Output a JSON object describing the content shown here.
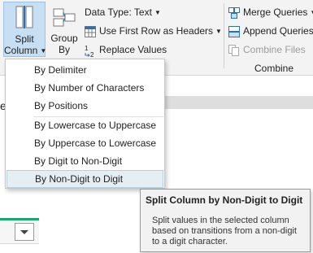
{
  "ribbon": {
    "split_column": {
      "line1": "Split",
      "line2": "Column"
    },
    "group_by": {
      "line1": "Group",
      "line2": "By"
    },
    "data_type": "Data Type: Text",
    "first_row_headers": "Use First Row as Headers",
    "replace_values": "Replace Values",
    "merge_queries": "Merge Queries",
    "append_queries": "Append Queries",
    "combine_files": "Combine Files",
    "combine_group_label": "Combine"
  },
  "menu": {
    "items": [
      {
        "label": "By Delimiter"
      },
      {
        "label": "By Number of Characters"
      },
      {
        "label": "By Positions"
      },
      {
        "label": "By Lowercase to Uppercase"
      },
      {
        "label": "By Uppercase to Lowercase"
      },
      {
        "label": "By Digit to Non-Digit"
      },
      {
        "label": "By Non-Digit to Digit"
      }
    ],
    "highlighted_index": 6
  },
  "tooltip": {
    "title": "Split Column by Non-Digit to Digit",
    "body": "Split values in the selected column based on transitions from a non-digit to a digit character."
  },
  "background": {
    "partial_text": "e"
  },
  "colors": {
    "accent_green": "#17a86b",
    "split_button_bg": "#c6dff3",
    "highlight_bg": "#e5eef3",
    "icon_blue": "#2e6fb0"
  }
}
